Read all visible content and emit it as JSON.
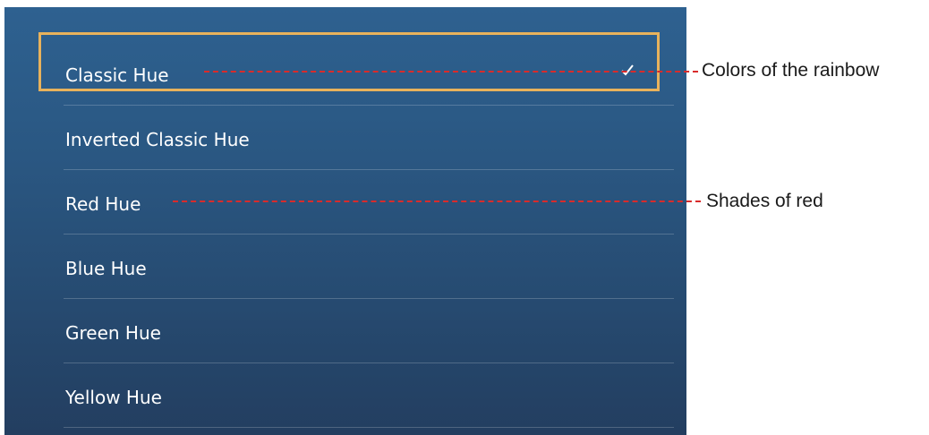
{
  "menu": {
    "items": [
      {
        "label": "Classic Hue",
        "selected": true
      },
      {
        "label": "Inverted Classic Hue",
        "selected": false
      },
      {
        "label": "Red Hue",
        "selected": false
      },
      {
        "label": "Blue Hue",
        "selected": false
      },
      {
        "label": "Green Hue",
        "selected": false
      },
      {
        "label": "Yellow Hue",
        "selected": false
      }
    ]
  },
  "callouts": [
    {
      "text": "Colors of the rainbow"
    },
    {
      "text": "Shades of red"
    }
  ],
  "colors": {
    "panel_top": "#2e6190",
    "panel_bottom": "#233e60",
    "highlight_border": "#e8b25c",
    "callout_line": "#d92b2b"
  },
  "icons": {
    "selected_marker": "checkmark-icon"
  }
}
